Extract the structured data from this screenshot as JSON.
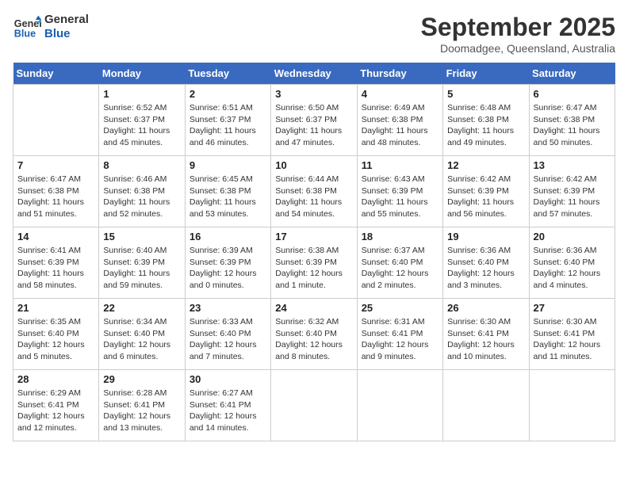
{
  "logo": {
    "line1": "General",
    "line2": "Blue"
  },
  "title": "September 2025",
  "location": "Doomadgee, Queensland, Australia",
  "days_of_week": [
    "Sunday",
    "Monday",
    "Tuesday",
    "Wednesday",
    "Thursday",
    "Friday",
    "Saturday"
  ],
  "weeks": [
    [
      {
        "day": "",
        "sunrise": "",
        "sunset": "",
        "daylight": ""
      },
      {
        "day": "1",
        "sunrise": "Sunrise: 6:52 AM",
        "sunset": "Sunset: 6:37 PM",
        "daylight": "Daylight: 11 hours and 45 minutes."
      },
      {
        "day": "2",
        "sunrise": "Sunrise: 6:51 AM",
        "sunset": "Sunset: 6:37 PM",
        "daylight": "Daylight: 11 hours and 46 minutes."
      },
      {
        "day": "3",
        "sunrise": "Sunrise: 6:50 AM",
        "sunset": "Sunset: 6:37 PM",
        "daylight": "Daylight: 11 hours and 47 minutes."
      },
      {
        "day": "4",
        "sunrise": "Sunrise: 6:49 AM",
        "sunset": "Sunset: 6:38 PM",
        "daylight": "Daylight: 11 hours and 48 minutes."
      },
      {
        "day": "5",
        "sunrise": "Sunrise: 6:48 AM",
        "sunset": "Sunset: 6:38 PM",
        "daylight": "Daylight: 11 hours and 49 minutes."
      },
      {
        "day": "6",
        "sunrise": "Sunrise: 6:47 AM",
        "sunset": "Sunset: 6:38 PM",
        "daylight": "Daylight: 11 hours and 50 minutes."
      }
    ],
    [
      {
        "day": "7",
        "sunrise": "Sunrise: 6:47 AM",
        "sunset": "Sunset: 6:38 PM",
        "daylight": "Daylight: 11 hours and 51 minutes."
      },
      {
        "day": "8",
        "sunrise": "Sunrise: 6:46 AM",
        "sunset": "Sunset: 6:38 PM",
        "daylight": "Daylight: 11 hours and 52 minutes."
      },
      {
        "day": "9",
        "sunrise": "Sunrise: 6:45 AM",
        "sunset": "Sunset: 6:38 PM",
        "daylight": "Daylight: 11 hours and 53 minutes."
      },
      {
        "day": "10",
        "sunrise": "Sunrise: 6:44 AM",
        "sunset": "Sunset: 6:38 PM",
        "daylight": "Daylight: 11 hours and 54 minutes."
      },
      {
        "day": "11",
        "sunrise": "Sunrise: 6:43 AM",
        "sunset": "Sunset: 6:39 PM",
        "daylight": "Daylight: 11 hours and 55 minutes."
      },
      {
        "day": "12",
        "sunrise": "Sunrise: 6:42 AM",
        "sunset": "Sunset: 6:39 PM",
        "daylight": "Daylight: 11 hours and 56 minutes."
      },
      {
        "day": "13",
        "sunrise": "Sunrise: 6:42 AM",
        "sunset": "Sunset: 6:39 PM",
        "daylight": "Daylight: 11 hours and 57 minutes."
      }
    ],
    [
      {
        "day": "14",
        "sunrise": "Sunrise: 6:41 AM",
        "sunset": "Sunset: 6:39 PM",
        "daylight": "Daylight: 11 hours and 58 minutes."
      },
      {
        "day": "15",
        "sunrise": "Sunrise: 6:40 AM",
        "sunset": "Sunset: 6:39 PM",
        "daylight": "Daylight: 11 hours and 59 minutes."
      },
      {
        "day": "16",
        "sunrise": "Sunrise: 6:39 AM",
        "sunset": "Sunset: 6:39 PM",
        "daylight": "Daylight: 12 hours and 0 minutes."
      },
      {
        "day": "17",
        "sunrise": "Sunrise: 6:38 AM",
        "sunset": "Sunset: 6:39 PM",
        "daylight": "Daylight: 12 hours and 1 minute."
      },
      {
        "day": "18",
        "sunrise": "Sunrise: 6:37 AM",
        "sunset": "Sunset: 6:40 PM",
        "daylight": "Daylight: 12 hours and 2 minutes."
      },
      {
        "day": "19",
        "sunrise": "Sunrise: 6:36 AM",
        "sunset": "Sunset: 6:40 PM",
        "daylight": "Daylight: 12 hours and 3 minutes."
      },
      {
        "day": "20",
        "sunrise": "Sunrise: 6:36 AM",
        "sunset": "Sunset: 6:40 PM",
        "daylight": "Daylight: 12 hours and 4 minutes."
      }
    ],
    [
      {
        "day": "21",
        "sunrise": "Sunrise: 6:35 AM",
        "sunset": "Sunset: 6:40 PM",
        "daylight": "Daylight: 12 hours and 5 minutes."
      },
      {
        "day": "22",
        "sunrise": "Sunrise: 6:34 AM",
        "sunset": "Sunset: 6:40 PM",
        "daylight": "Daylight: 12 hours and 6 minutes."
      },
      {
        "day": "23",
        "sunrise": "Sunrise: 6:33 AM",
        "sunset": "Sunset: 6:40 PM",
        "daylight": "Daylight: 12 hours and 7 minutes."
      },
      {
        "day": "24",
        "sunrise": "Sunrise: 6:32 AM",
        "sunset": "Sunset: 6:40 PM",
        "daylight": "Daylight: 12 hours and 8 minutes."
      },
      {
        "day": "25",
        "sunrise": "Sunrise: 6:31 AM",
        "sunset": "Sunset: 6:41 PM",
        "daylight": "Daylight: 12 hours and 9 minutes."
      },
      {
        "day": "26",
        "sunrise": "Sunrise: 6:30 AM",
        "sunset": "Sunset: 6:41 PM",
        "daylight": "Daylight: 12 hours and 10 minutes."
      },
      {
        "day": "27",
        "sunrise": "Sunrise: 6:30 AM",
        "sunset": "Sunset: 6:41 PM",
        "daylight": "Daylight: 12 hours and 11 minutes."
      }
    ],
    [
      {
        "day": "28",
        "sunrise": "Sunrise: 6:29 AM",
        "sunset": "Sunset: 6:41 PM",
        "daylight": "Daylight: 12 hours and 12 minutes."
      },
      {
        "day": "29",
        "sunrise": "Sunrise: 6:28 AM",
        "sunset": "Sunset: 6:41 PM",
        "daylight": "Daylight: 12 hours and 13 minutes."
      },
      {
        "day": "30",
        "sunrise": "Sunrise: 6:27 AM",
        "sunset": "Sunset: 6:41 PM",
        "daylight": "Daylight: 12 hours and 14 minutes."
      },
      {
        "day": "",
        "sunrise": "",
        "sunset": "",
        "daylight": ""
      },
      {
        "day": "",
        "sunrise": "",
        "sunset": "",
        "daylight": ""
      },
      {
        "day": "",
        "sunrise": "",
        "sunset": "",
        "daylight": ""
      },
      {
        "day": "",
        "sunrise": "",
        "sunset": "",
        "daylight": ""
      }
    ]
  ]
}
